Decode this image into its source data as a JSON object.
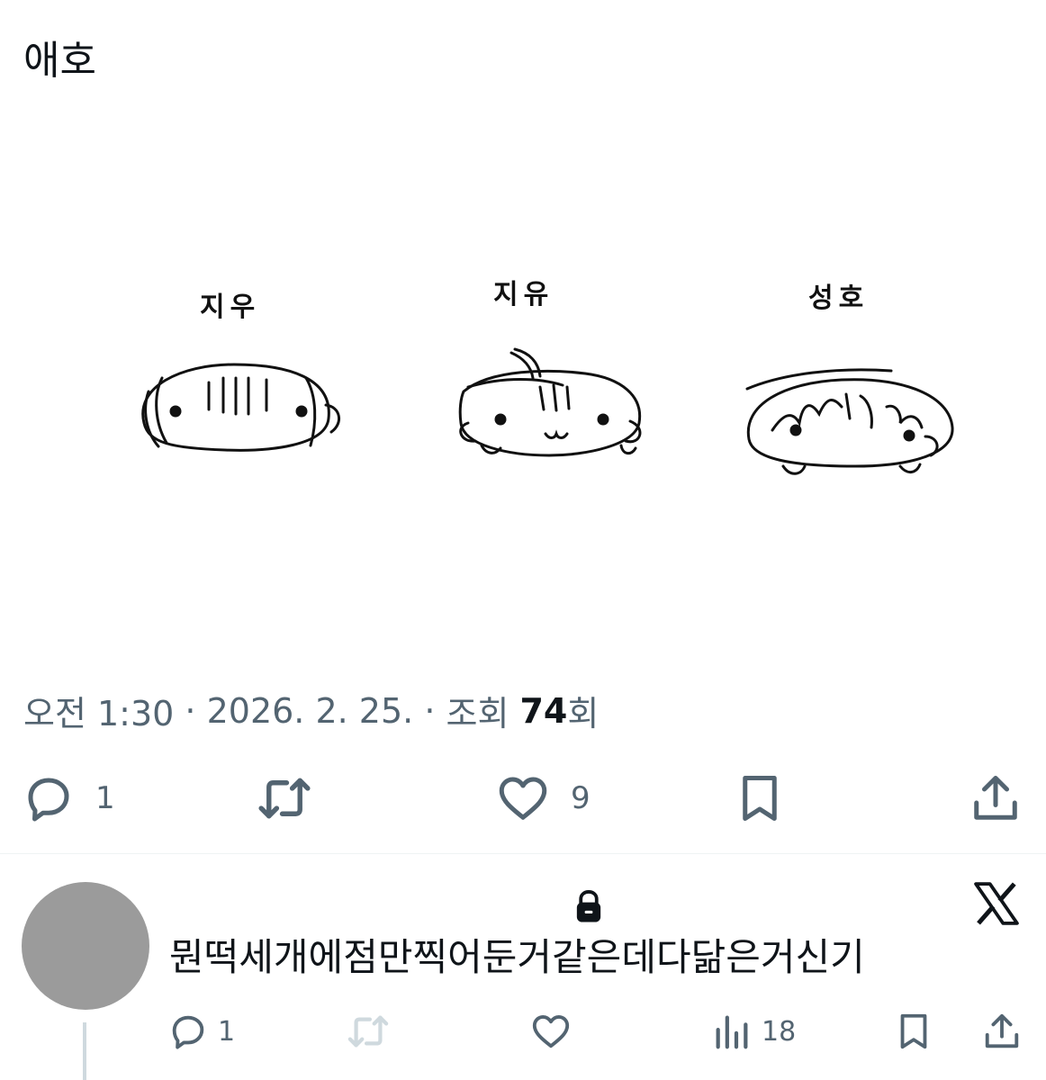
{
  "post": {
    "text": "애호",
    "drawing": {
      "labels": [
        "지우",
        "지유",
        "성호"
      ]
    },
    "meta": {
      "time": "오전 1:30",
      "sep1": " · ",
      "date": "2026. 2. 25.",
      "sep2": " · ",
      "views_prefix": "조회 ",
      "views_count": "74",
      "views_suffix": "회"
    },
    "actions": {
      "reply_count": "1",
      "like_count": "9"
    }
  },
  "reply": {
    "text": "뭔떡세개에점만찍어둔거같은데다닮은거신기",
    "reply_count": "1",
    "views_count": "18",
    "protected_icon": "lock-icon",
    "brand_icon": "x-logo-icon"
  },
  "colors": {
    "text": "#0f1419",
    "muted": "#536471",
    "divider": "#eff3f4",
    "avatar": "#9b9b9b"
  }
}
